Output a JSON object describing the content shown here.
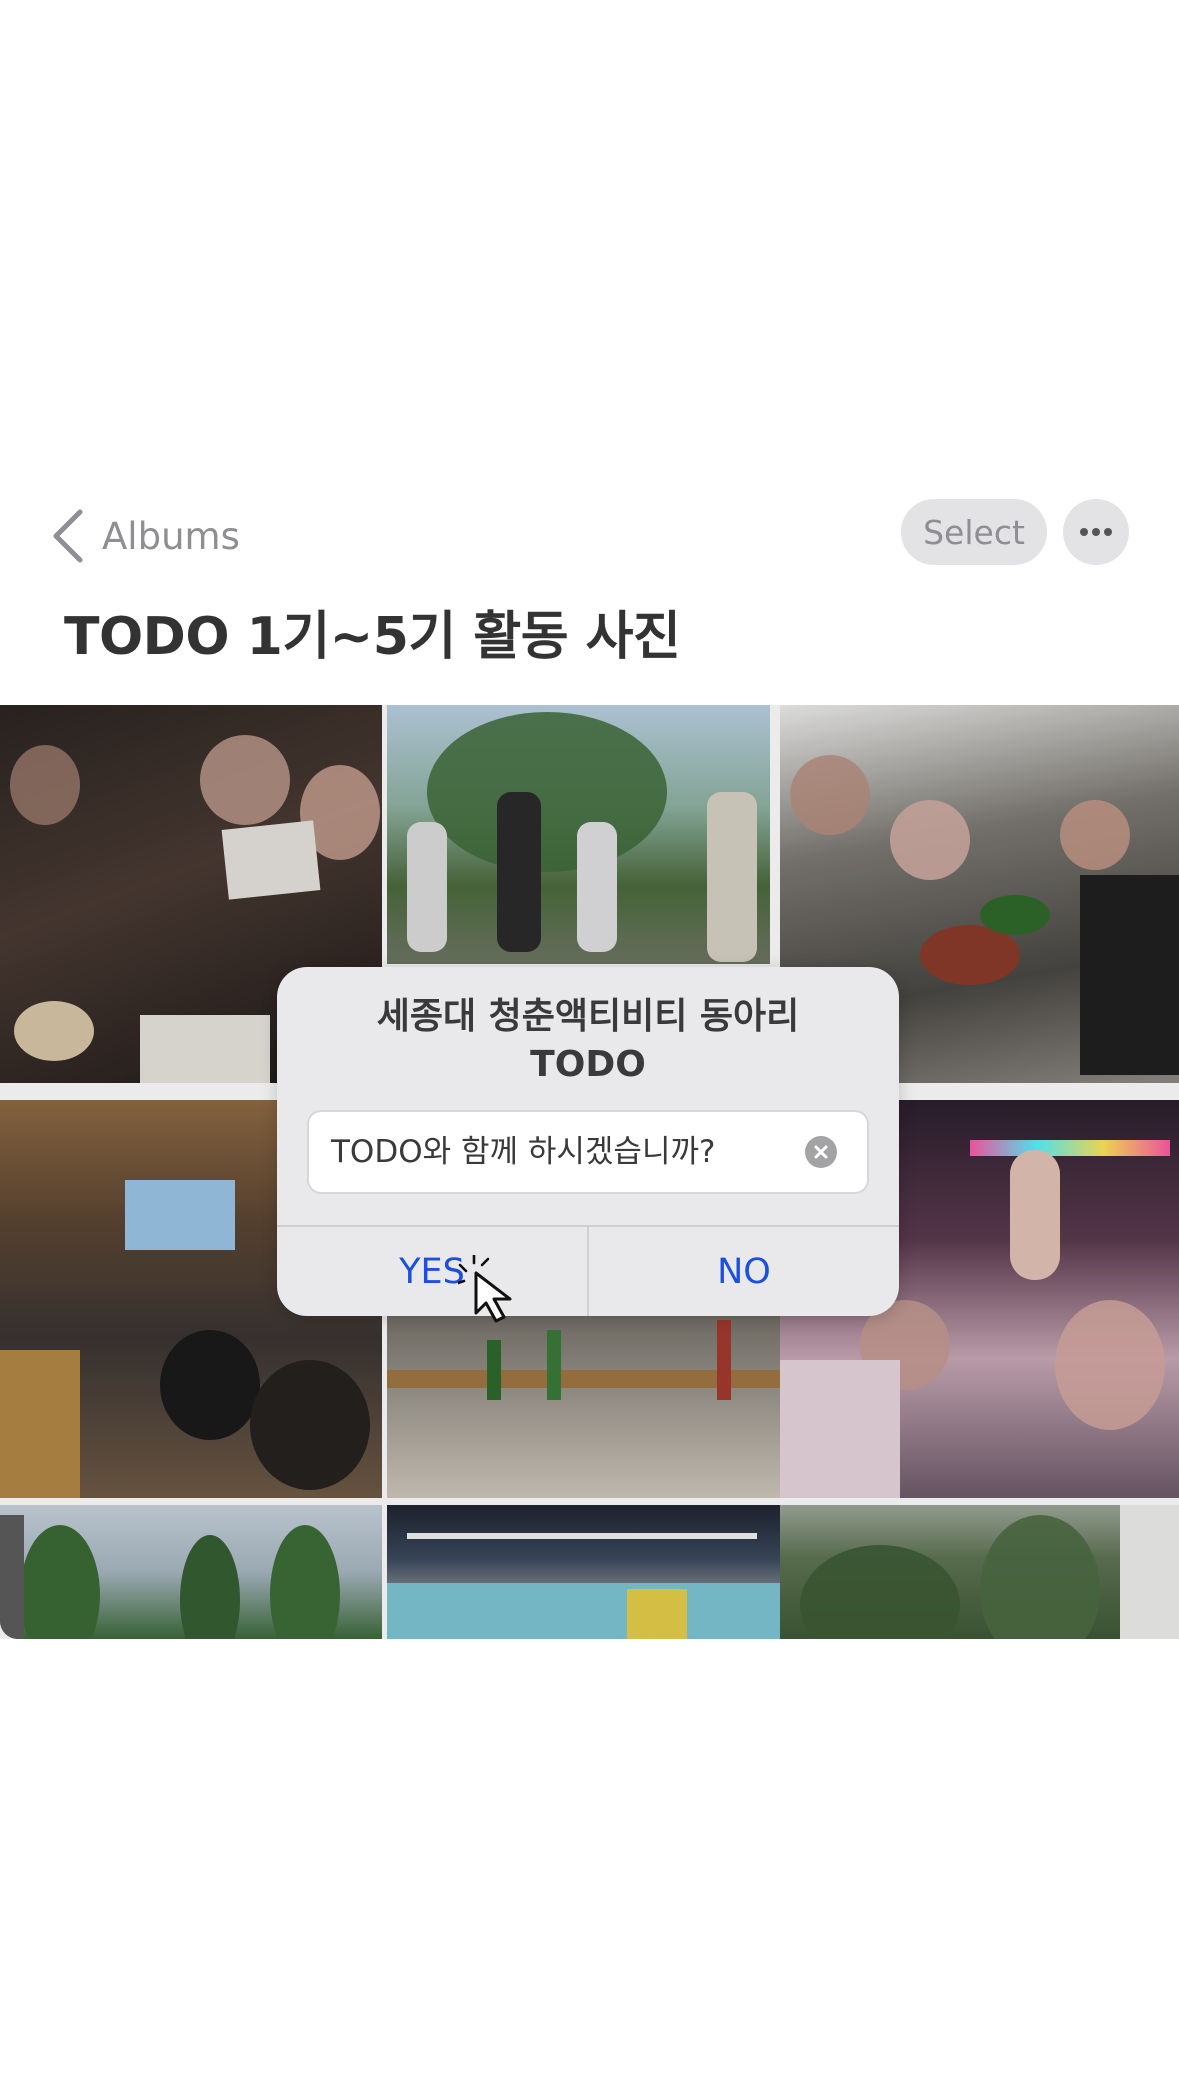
{
  "nav": {
    "back_label": "Albums",
    "select_label": "Select"
  },
  "album": {
    "title": "TODO 1기~5기 활동 사진"
  },
  "photos": [
    {
      "description": "group at restaurant with tablets"
    },
    {
      "description": "people walking under trees"
    },
    {
      "description": "dinner under tent"
    },
    {
      "description": "restaurant with projector screen"
    },
    {
      "description": "table with bottles"
    },
    {
      "description": "people on a bus"
    },
    {
      "description": "tall trees"
    },
    {
      "description": "indoor studio"
    },
    {
      "description": "forest greenery"
    }
  ],
  "dialog": {
    "title_line1": "세종대 청춘액티비티 동아리",
    "title_line2": "TODO",
    "input_value": "TODO와 함께 하시겠습니까?",
    "yes_label": "YES",
    "no_label": "NO"
  },
  "colors": {
    "accent": "#1a4fe0",
    "chip_bg": "#e3e3e5",
    "dialog_bg": "#e9e9eb"
  }
}
